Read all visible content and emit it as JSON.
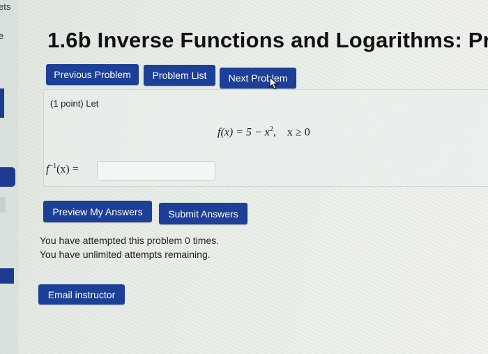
{
  "sidebar": {
    "fragment_top": "ets",
    "fragment_second": "e"
  },
  "page": {
    "title": "1.6b Inverse Functions and Logarithms: Pr"
  },
  "nav": {
    "previous_label": "Previous Problem",
    "list_label": "Problem List",
    "next_label": "Next Problem"
  },
  "problem": {
    "intro": "(1 point) Let",
    "formula_left": "f(x) = 5 − x",
    "formula_exp": "2",
    "formula_right": ",    x ≥ 0",
    "answer_prefix": "f",
    "answer_exp": "−1",
    "answer_suffix": "(x) =",
    "answer_value": ""
  },
  "actions": {
    "preview_label": "Preview My Answers",
    "submit_label": "Submit Answers"
  },
  "status": {
    "attempts_line": "You have attempted this problem 0 times.",
    "remaining_line": "You have unlimited attempts remaining."
  },
  "footer": {
    "email_label": "Email instructor"
  },
  "colors": {
    "button_bg": "#1c3f97",
    "button_text": "#ffffff"
  }
}
